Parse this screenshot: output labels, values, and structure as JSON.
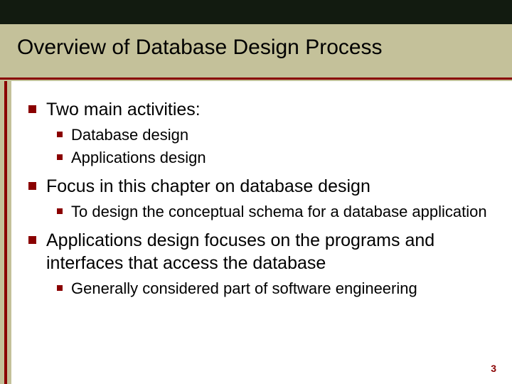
{
  "title": "Overview of Database Design Process",
  "b1": "Two main activities:",
  "b1a": "Database design",
  "b1b": "Applications design",
  "b2": "Focus in this chapter on database design",
  "b2a": "To design the conceptual schema for a database application",
  "b3": "Applications design focuses on the programs and interfaces that access the database",
  "b3a": "Generally considered part of software engineering",
  "slide_number": "3",
  "colors": {
    "accent": "#8a0000",
    "band": "#c4c19a",
    "top": "#121b10"
  }
}
